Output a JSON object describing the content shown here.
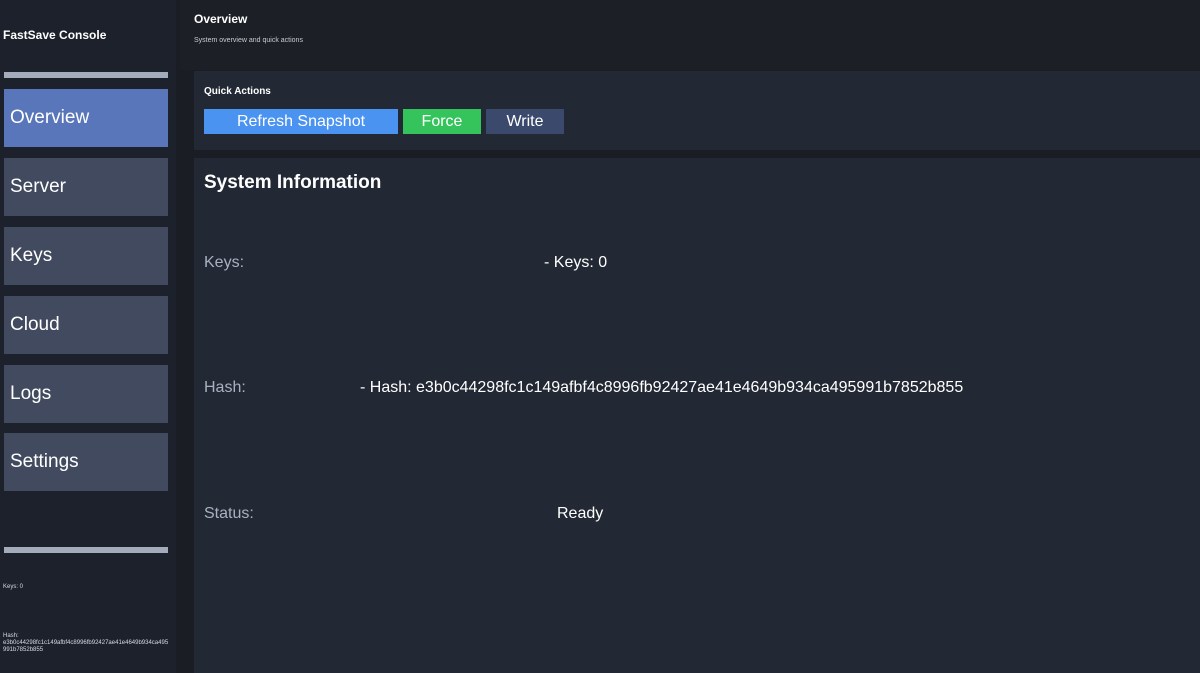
{
  "app": {
    "title": "FastSave Console"
  },
  "sidebar": {
    "items": [
      {
        "label": "Overview"
      },
      {
        "label": "Server"
      },
      {
        "label": "Keys"
      },
      {
        "label": "Cloud"
      },
      {
        "label": "Logs"
      },
      {
        "label": "Settings"
      }
    ],
    "footer": {
      "keys": "Keys: 0",
      "hash_label": "Hash:",
      "hash_value": "e3b0c44298fc1c149afbf4c8996fb92427ae41e4649b934ca495991b7852b855"
    }
  },
  "header": {
    "title": "Overview",
    "subtitle": "System overview and quick actions"
  },
  "quick_actions": {
    "title": "Quick Actions",
    "refresh_label": "Refresh Snapshot",
    "force_label": "Force",
    "write_label": "Write"
  },
  "system_info": {
    "title": "System Information",
    "keys_label": "Keys:",
    "keys_value": "- Keys: 0",
    "hash_label": "Hash:",
    "hash_value": "- Hash: e3b0c44298fc1c149afbf4c8996fb92427ae41e4649b934ca495991b7852b855",
    "status_label": "Status:",
    "status_value": "Ready"
  },
  "colors": {
    "accent": "#5876b9",
    "refresh": "#4a93f0",
    "force": "#35c45c",
    "write": "#3b4a6c"
  }
}
